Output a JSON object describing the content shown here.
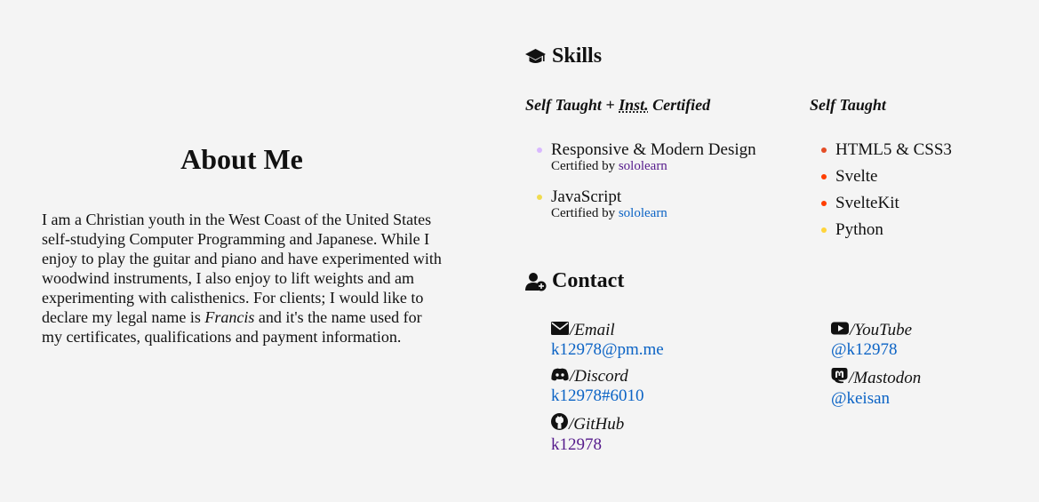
{
  "about": {
    "title": "About Me",
    "text_1": "I am a Christian youth in the West Coast of the United States self-studying Computer Programming and Japanese. While I enjoy to play the guitar and piano and have experimented with woodwind instruments, I also enjoy to lift weights and am experimenting with calisthenics. For clients; I would like to declare my legal name is ",
    "name_em": "Francis",
    "text_2": " and it's the name used for my certificates, qualifications and payment information."
  },
  "skills": {
    "heading": "Skills",
    "icon": "graduation-cap-icon",
    "col1_title_a": "Self Taught + ",
    "col1_title_abbr": "Inst.",
    "col1_title_b": " Certified",
    "col2_title": "Self Taught",
    "certified": [
      {
        "name": "Responsive & Modern Design",
        "cert_prefix": "Certified by ",
        "cert_link": "sololearn",
        "dot_color": "#d9b8ff",
        "link_color": "#551a8b"
      },
      {
        "name": "JavaScript",
        "cert_prefix": "Certified by ",
        "cert_link": "sololearn",
        "dot_color": "#f0db4f",
        "link_color": "#0b63c5"
      }
    ],
    "self_taught": [
      {
        "name": "HTML5 & CSS3",
        "dot_color": "#e44d26"
      },
      {
        "name": "Svelte",
        "dot_color": "#ff3e00"
      },
      {
        "name": "SvelteKit",
        "dot_color": "#ff3e00"
      },
      {
        "name": "Python",
        "dot_color": "#ffd43b"
      }
    ]
  },
  "contact": {
    "heading": "Contact",
    "icon": "user-plus-icon",
    "email": {
      "label": "/Email",
      "value": "k12978@pm.me",
      "color": "#0b63c5",
      "icon": "envelope-icon"
    },
    "discord": {
      "label": "/Discord",
      "value": "k12978#6010",
      "color": "#0b63c5",
      "icon": "discord-icon"
    },
    "github": {
      "label": "/GitHub",
      "value": "k12978",
      "color": "#551a8b",
      "icon": "github-icon"
    },
    "youtube": {
      "label": "/YouTube",
      "value": "@k12978",
      "color": "#0b63c5",
      "icon": "youtube-icon"
    },
    "mastodon": {
      "label": "/Mastodon",
      "value": "@keisan",
      "color": "#0b63c5",
      "icon": "mastodon-icon"
    }
  }
}
